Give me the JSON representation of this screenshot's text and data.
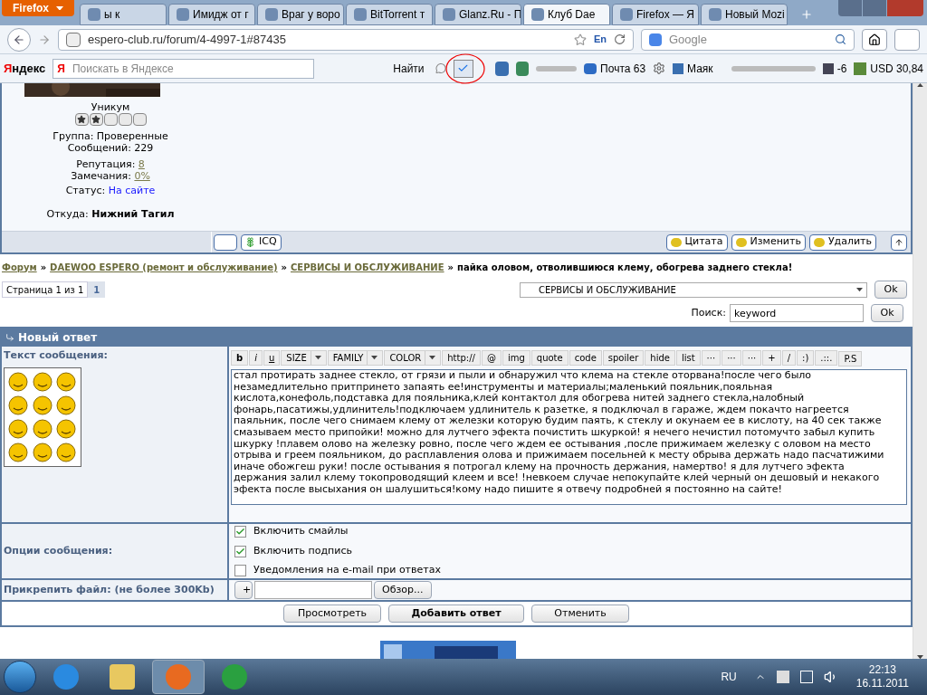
{
  "browser": {
    "menu_button": "Firefox",
    "tabs": [
      {
        "label": "ы к",
        "selected": false
      },
      {
        "label": "Имидж от г",
        "selected": false
      },
      {
        "label": "Враг у воро",
        "selected": false
      },
      {
        "label": "BitTorrent т",
        "selected": false
      },
      {
        "label": "Glanz.Ru - П",
        "selected": false
      },
      {
        "label": "Клуб Dae",
        "selected": true
      },
      {
        "label": "Firefox — Я",
        "selected": false
      },
      {
        "label": "Новый Mozi",
        "selected": false
      }
    ],
    "address": "espero-club.ru/forum/4-4997-1#87435",
    "translate_label": "En",
    "search_placeholder": "Google"
  },
  "yandex_bar": {
    "logo": "Яндекс",
    "search_logo": "Я",
    "search_placeholder": "Поискать в Яндексе",
    "find_button": "Найти",
    "mail": "Почта 63",
    "lighthouse": "Маяк",
    "weather": "-6",
    "currency": "USD 30,84"
  },
  "profile": {
    "rank": "Уникум",
    "stars": 2,
    "group": "Группа: Проверенные",
    "posts": "Сообщений: 229",
    "reputation_label": "Репутация:",
    "reputation": "8",
    "warnings_label": "Замечания:",
    "warnings": "0%",
    "status_label": "Статус:",
    "status": "На сайте",
    "from_label": "Откуда:",
    "from": "Нижний Тагил",
    "icq": "ICQ",
    "actions": [
      "Цитата",
      "Изменить",
      "Удалить"
    ]
  },
  "breadcrumb": [
    {
      "kind": "link",
      "text": "Форум"
    },
    {
      "kind": "sep",
      "text": "»"
    },
    {
      "kind": "link",
      "text": "DAEWOO ESPERO (ремонт и обслуживание)"
    },
    {
      "kind": "sep",
      "text": "»"
    },
    {
      "kind": "link",
      "text": "СЕРВИСЫ И ОБСЛУЖИВАНИЕ"
    },
    {
      "kind": "sep",
      "text": "»"
    },
    {
      "kind": "current",
      "text": "пайка оловом, отволившиюся клему, обогрева заднего стекла!"
    }
  ],
  "pages": {
    "label": "Страница 1 из 1",
    "current": "1"
  },
  "jump": {
    "value": "СЕРВИСЫ И ОБСЛУЖИВАНИЕ",
    "button": "Ok"
  },
  "search": {
    "label": "Поиск:",
    "value": "keyword",
    "button": "Ok"
  },
  "reply": {
    "title": "Новый ответ",
    "text_label": "Текст сообщения:",
    "toolbar": [
      {
        "label": "b",
        "kind": "bold"
      },
      {
        "label": "i",
        "kind": "italic"
      },
      {
        "label": "u",
        "kind": "underline"
      },
      {
        "label": "SIZE",
        "kind": "dropdown"
      },
      {
        "label": "FAMILY",
        "kind": "dropdown"
      },
      {
        "label": "COLOR",
        "kind": "dropdown"
      },
      {
        "label": "http://",
        "kind": "plain"
      },
      {
        "label": "@",
        "kind": "plain"
      },
      {
        "label": "img",
        "kind": "plain"
      },
      {
        "label": "quote",
        "kind": "plain"
      },
      {
        "label": "code",
        "kind": "plain"
      },
      {
        "label": "spoiler",
        "kind": "plain"
      },
      {
        "label": "hide",
        "kind": "plain"
      },
      {
        "label": "list",
        "kind": "plain"
      },
      {
        "label": "···",
        "kind": "plain"
      },
      {
        "label": "···",
        "kind": "plain"
      },
      {
        "label": "···",
        "kind": "plain"
      },
      {
        "label": "+",
        "kind": "plain"
      },
      {
        "label": "/",
        "kind": "plain"
      },
      {
        "label": ":)",
        "kind": "plain"
      },
      {
        "label": ".::.",
        "kind": "plain"
      },
      {
        "label": "P.S",
        "kind": "plain"
      }
    ],
    "message": "стал протирать заднее стекло, от грязи и пыли и обнаружил что клема на стекле оторвана!после чего было незамедлительно притпринето запаять ее!инструменты и материалы;маленький пояльник,пояльная кислота,конефоль,подставка для пояльника,клей контактол для обогрева нитей заднего стекла,налобный фонарь,пасатижы,удлинитель!подключаем удлинитель к разетке, я подключал в гараже, ждем покачто нагреется паяльник, после чего снимаем клему от железки которую будим паять, к стеклу и окунаем ее в кислоту, на 40 сек также смазываем место припойки! можно для лутчего эфекта почистить шкуркой! я нечего нечистил потомучто забыл купить шкурку !плавем олово на железку ровно, после чего ждем ее остывания ,после прижимаем железку с оловом на место отрыва и греем пояльником, до расплавления олова и прижимаем посельней к месту обрыва держать надо пасчатижими иначе обожгеш руки! после остывания я потрогал клему на прочность держания, намертво! я для лутчего эфекта держания залил клему токопроводящий клеем и все! !невкоем случае непокупайте клей черный он дешовый и некакого эфекта после высыхания он шалушиться!кому надо пишите я отвечу подробней я постоянно на сайте!",
    "options_label": "Опции сообщения:",
    "options": [
      {
        "label": "Включить смайлы",
        "checked": true
      },
      {
        "label": "Включить подпись",
        "checked": true
      },
      {
        "label": "Уведомления на e-mail при ответах",
        "checked": false
      }
    ],
    "attach_label": "Прикрепить файл: (не более 300Kb)",
    "add_button": "+",
    "browse_button": "Обзор...",
    "buttons": [
      {
        "label": "Просмотреть",
        "kind": "normal"
      },
      {
        "label": "Добавить ответ",
        "kind": "primary"
      },
      {
        "label": "Отменить",
        "kind": "normal"
      }
    ]
  },
  "taskbar": {
    "language": "RU",
    "time": "22:13",
    "date": "16.11.2011"
  }
}
